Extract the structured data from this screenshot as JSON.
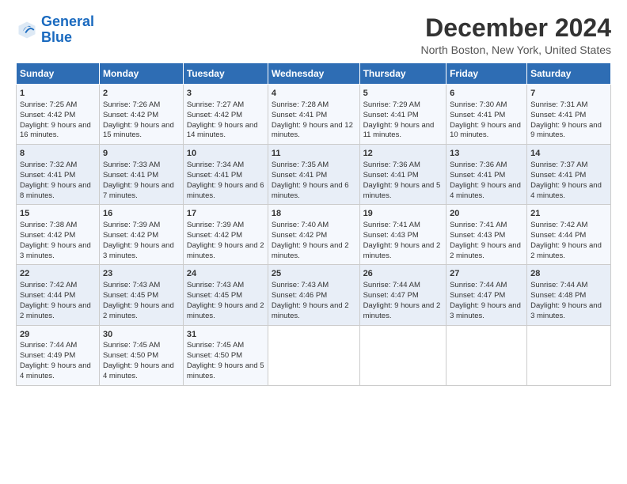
{
  "logo": {
    "line1": "General",
    "line2": "Blue"
  },
  "title": "December 2024",
  "subtitle": "North Boston, New York, United States",
  "headers": [
    "Sunday",
    "Monday",
    "Tuesday",
    "Wednesday",
    "Thursday",
    "Friday",
    "Saturday"
  ],
  "weeks": [
    [
      {
        "day": "1",
        "sunrise": "Sunrise: 7:25 AM",
        "sunset": "Sunset: 4:42 PM",
        "daylight": "Daylight: 9 hours and 16 minutes."
      },
      {
        "day": "2",
        "sunrise": "Sunrise: 7:26 AM",
        "sunset": "Sunset: 4:42 PM",
        "daylight": "Daylight: 9 hours and 15 minutes."
      },
      {
        "day": "3",
        "sunrise": "Sunrise: 7:27 AM",
        "sunset": "Sunset: 4:42 PM",
        "daylight": "Daylight: 9 hours and 14 minutes."
      },
      {
        "day": "4",
        "sunrise": "Sunrise: 7:28 AM",
        "sunset": "Sunset: 4:41 PM",
        "daylight": "Daylight: 9 hours and 12 minutes."
      },
      {
        "day": "5",
        "sunrise": "Sunrise: 7:29 AM",
        "sunset": "Sunset: 4:41 PM",
        "daylight": "Daylight: 9 hours and 11 minutes."
      },
      {
        "day": "6",
        "sunrise": "Sunrise: 7:30 AM",
        "sunset": "Sunset: 4:41 PM",
        "daylight": "Daylight: 9 hours and 10 minutes."
      },
      {
        "day": "7",
        "sunrise": "Sunrise: 7:31 AM",
        "sunset": "Sunset: 4:41 PM",
        "daylight": "Daylight: 9 hours and 9 minutes."
      }
    ],
    [
      {
        "day": "8",
        "sunrise": "Sunrise: 7:32 AM",
        "sunset": "Sunset: 4:41 PM",
        "daylight": "Daylight: 9 hours and 8 minutes."
      },
      {
        "day": "9",
        "sunrise": "Sunrise: 7:33 AM",
        "sunset": "Sunset: 4:41 PM",
        "daylight": "Daylight: 9 hours and 7 minutes."
      },
      {
        "day": "10",
        "sunrise": "Sunrise: 7:34 AM",
        "sunset": "Sunset: 4:41 PM",
        "daylight": "Daylight: 9 hours and 6 minutes."
      },
      {
        "day": "11",
        "sunrise": "Sunrise: 7:35 AM",
        "sunset": "Sunset: 4:41 PM",
        "daylight": "Daylight: 9 hours and 6 minutes."
      },
      {
        "day": "12",
        "sunrise": "Sunrise: 7:36 AM",
        "sunset": "Sunset: 4:41 PM",
        "daylight": "Daylight: 9 hours and 5 minutes."
      },
      {
        "day": "13",
        "sunrise": "Sunrise: 7:36 AM",
        "sunset": "Sunset: 4:41 PM",
        "daylight": "Daylight: 9 hours and 4 minutes."
      },
      {
        "day": "14",
        "sunrise": "Sunrise: 7:37 AM",
        "sunset": "Sunset: 4:41 PM",
        "daylight": "Daylight: 9 hours and 4 minutes."
      }
    ],
    [
      {
        "day": "15",
        "sunrise": "Sunrise: 7:38 AM",
        "sunset": "Sunset: 4:42 PM",
        "daylight": "Daylight: 9 hours and 3 minutes."
      },
      {
        "day": "16",
        "sunrise": "Sunrise: 7:39 AM",
        "sunset": "Sunset: 4:42 PM",
        "daylight": "Daylight: 9 hours and 3 minutes."
      },
      {
        "day": "17",
        "sunrise": "Sunrise: 7:39 AM",
        "sunset": "Sunset: 4:42 PM",
        "daylight": "Daylight: 9 hours and 2 minutes."
      },
      {
        "day": "18",
        "sunrise": "Sunrise: 7:40 AM",
        "sunset": "Sunset: 4:42 PM",
        "daylight": "Daylight: 9 hours and 2 minutes."
      },
      {
        "day": "19",
        "sunrise": "Sunrise: 7:41 AM",
        "sunset": "Sunset: 4:43 PM",
        "daylight": "Daylight: 9 hours and 2 minutes."
      },
      {
        "day": "20",
        "sunrise": "Sunrise: 7:41 AM",
        "sunset": "Sunset: 4:43 PM",
        "daylight": "Daylight: 9 hours and 2 minutes."
      },
      {
        "day": "21",
        "sunrise": "Sunrise: 7:42 AM",
        "sunset": "Sunset: 4:44 PM",
        "daylight": "Daylight: 9 hours and 2 minutes."
      }
    ],
    [
      {
        "day": "22",
        "sunrise": "Sunrise: 7:42 AM",
        "sunset": "Sunset: 4:44 PM",
        "daylight": "Daylight: 9 hours and 2 minutes."
      },
      {
        "day": "23",
        "sunrise": "Sunrise: 7:43 AM",
        "sunset": "Sunset: 4:45 PM",
        "daylight": "Daylight: 9 hours and 2 minutes."
      },
      {
        "day": "24",
        "sunrise": "Sunrise: 7:43 AM",
        "sunset": "Sunset: 4:45 PM",
        "daylight": "Daylight: 9 hours and 2 minutes."
      },
      {
        "day": "25",
        "sunrise": "Sunrise: 7:43 AM",
        "sunset": "Sunset: 4:46 PM",
        "daylight": "Daylight: 9 hours and 2 minutes."
      },
      {
        "day": "26",
        "sunrise": "Sunrise: 7:44 AM",
        "sunset": "Sunset: 4:47 PM",
        "daylight": "Daylight: 9 hours and 2 minutes."
      },
      {
        "day": "27",
        "sunrise": "Sunrise: 7:44 AM",
        "sunset": "Sunset: 4:47 PM",
        "daylight": "Daylight: 9 hours and 3 minutes."
      },
      {
        "day": "28",
        "sunrise": "Sunrise: 7:44 AM",
        "sunset": "Sunset: 4:48 PM",
        "daylight": "Daylight: 9 hours and 3 minutes."
      }
    ],
    [
      {
        "day": "29",
        "sunrise": "Sunrise: 7:44 AM",
        "sunset": "Sunset: 4:49 PM",
        "daylight": "Daylight: 9 hours and 4 minutes."
      },
      {
        "day": "30",
        "sunrise": "Sunrise: 7:45 AM",
        "sunset": "Sunset: 4:50 PM",
        "daylight": "Daylight: 9 hours and 4 minutes."
      },
      {
        "day": "31",
        "sunrise": "Sunrise: 7:45 AM",
        "sunset": "Sunset: 4:50 PM",
        "daylight": "Daylight: 9 hours and 5 minutes."
      },
      null,
      null,
      null,
      null
    ]
  ]
}
